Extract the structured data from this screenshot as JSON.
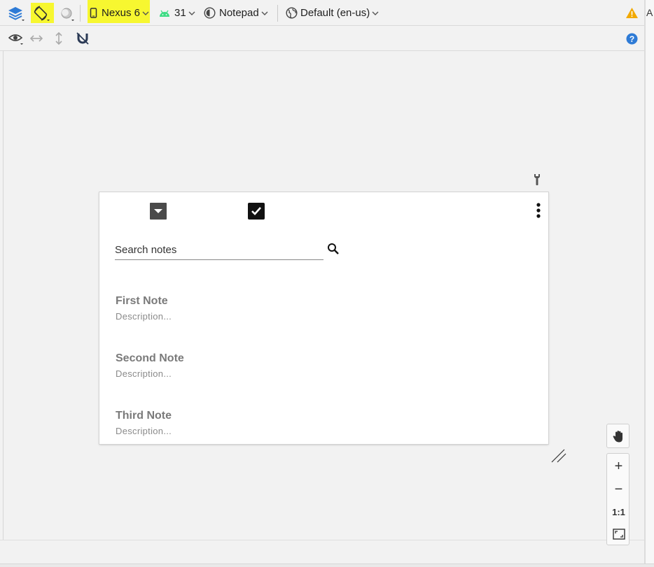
{
  "toolbar": {
    "device_label": "Nexus 6",
    "api_label": "31",
    "theme_label": "Notepad",
    "locale_label": "Default (en-us)",
    "right_edge_letter": "A"
  },
  "preview": {
    "search_placeholder": "Search notes",
    "notes": [
      {
        "title": "First Note",
        "description": "Description..."
      },
      {
        "title": "Second Note",
        "description": "Description..."
      },
      {
        "title": "Third Note",
        "description": "Description..."
      }
    ]
  },
  "zoom": {
    "zoom_in": "+",
    "zoom_out": "−",
    "actual_size": "1:1"
  },
  "colors": {
    "highlight": "#f7f730",
    "accent_blue": "#2e7bd6",
    "warning": "#f2a900",
    "android_green": "#3ddc84"
  }
}
